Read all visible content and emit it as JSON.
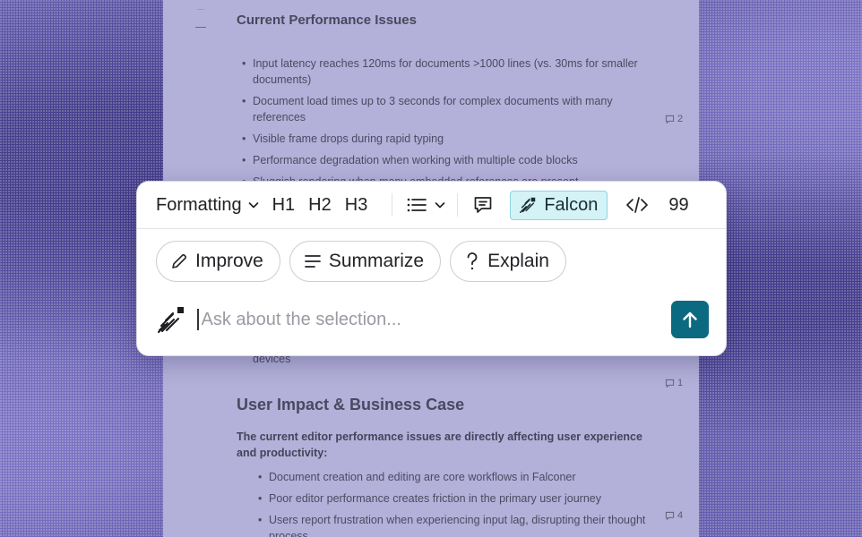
{
  "colors": {
    "backdrop": "#5a53a5",
    "document": "#b3b0d9",
    "falcon_bg": "#d4f3f7",
    "falcon_border": "#8fd3df",
    "send_button": "#0b6a80"
  },
  "document": {
    "performance": {
      "heading": "Current Performance Issues",
      "bullets": [
        "Input latency reaches 120ms for documents >1000 lines (vs. 30ms for smaller documents)",
        "Document load times up to 3 seconds for complex documents with many references",
        "Visible frame drops during rapid typing",
        "Performance degradation when working with multiple code blocks",
        "Sluggish rendering when many embedded references are present"
      ],
      "trailing_text": "devices",
      "comment_counts": [
        "2",
        "1"
      ]
    },
    "impact": {
      "heading": "User Impact & Business Case",
      "intro": "The current editor performance issues are directly affecting user experience and productivity:",
      "bullets": [
        "Document creation and editing are core workflows in Falconer",
        "Poor editor performance creates friction in the primary user journey",
        "Users report frustration when experiencing input lag, disrupting their thought process"
      ],
      "comment_count": "4"
    }
  },
  "toolbar": {
    "formatting_label": "Formatting",
    "h1": "H1",
    "h2": "H2",
    "h3": "H3",
    "falcon_label": "Falcon",
    "quote_label": "99",
    "icons": [
      "chevron-down-icon",
      "list-icon",
      "comment-icon",
      "falcon-icon",
      "code-icon"
    ]
  },
  "actions": {
    "improve": "Improve",
    "summarize": "Summarize",
    "explain": "Explain"
  },
  "ask": {
    "placeholder": "Ask about the selection..."
  }
}
